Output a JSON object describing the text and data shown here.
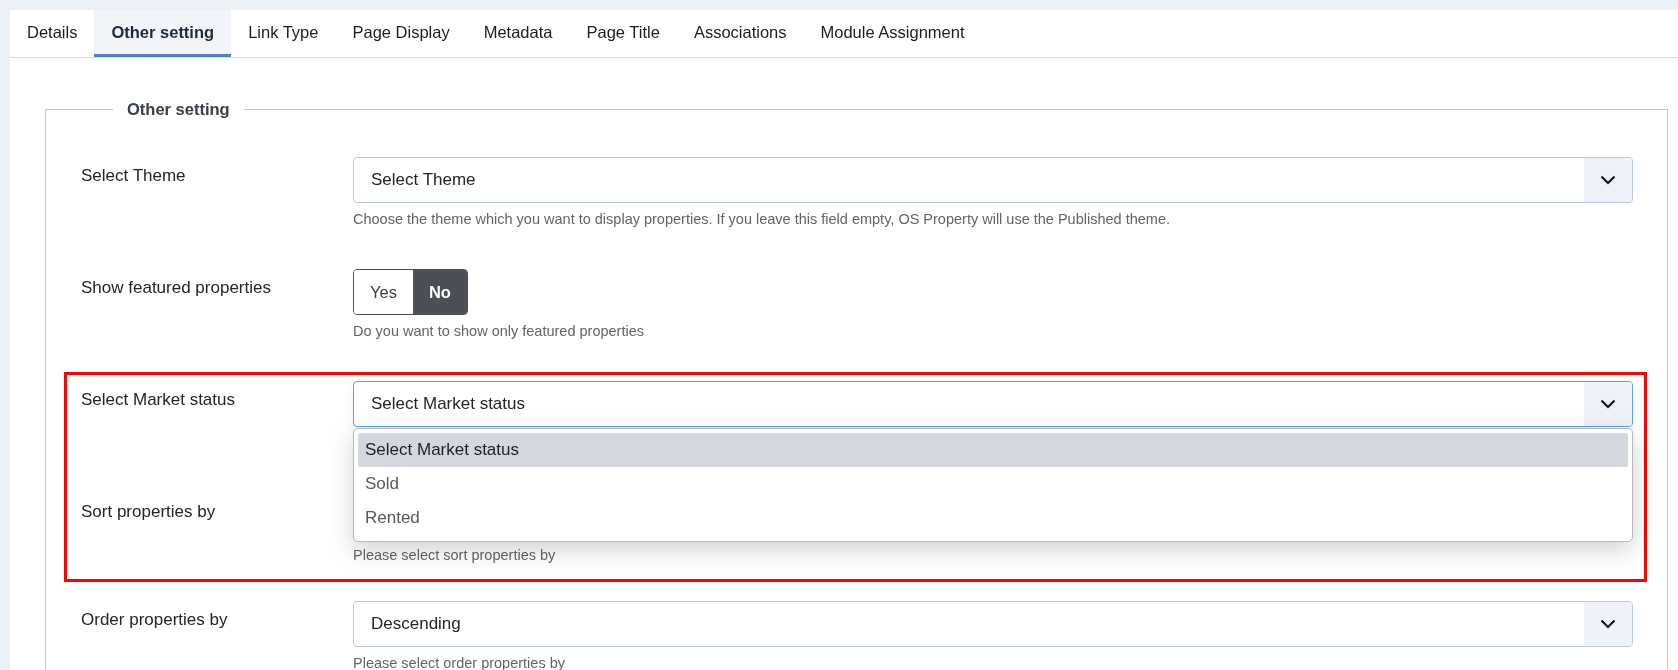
{
  "tabs": [
    {
      "label": "Details",
      "selected": false
    },
    {
      "label": "Other setting",
      "selected": true
    },
    {
      "label": "Link Type",
      "selected": false
    },
    {
      "label": "Page Display",
      "selected": false
    },
    {
      "label": "Metadata",
      "selected": false
    },
    {
      "label": "Page Title",
      "selected": false
    },
    {
      "label": "Associations",
      "selected": false
    },
    {
      "label": "Module Assignment",
      "selected": false
    }
  ],
  "fieldset": {
    "legend": "Other setting",
    "fields": [
      {
        "kind": "select",
        "label": "Select Theme",
        "value": "Select Theme",
        "focused": false,
        "help": "Choose the theme which you want to display properties. If you leave this field empty, OS Property will use the Published theme.",
        "highlighted": false
      },
      {
        "kind": "toggle",
        "label": "Show featured properties",
        "options": [
          {
            "label": "Yes",
            "selected": false
          },
          {
            "label": "No",
            "selected": true
          }
        ],
        "help": "Do you want to show only featured properties",
        "highlighted": false
      },
      {
        "kind": "select",
        "label": "Select Market status",
        "value": "Select Market status",
        "focused": true,
        "highlighted": true,
        "menu": [
          {
            "label": "Select Market status",
            "selected": true
          },
          {
            "label": "Sold",
            "selected": false
          },
          {
            "label": "Rented",
            "selected": false
          }
        ]
      },
      {
        "kind": "select-hidden",
        "label": "Sort properties by",
        "help": "Please select sort properties by",
        "highlighted": true
      },
      {
        "kind": "select",
        "label": "Order properties by",
        "value": "Descending",
        "focused": false,
        "help": "Please select order properties by",
        "highlighted": false
      }
    ]
  }
}
